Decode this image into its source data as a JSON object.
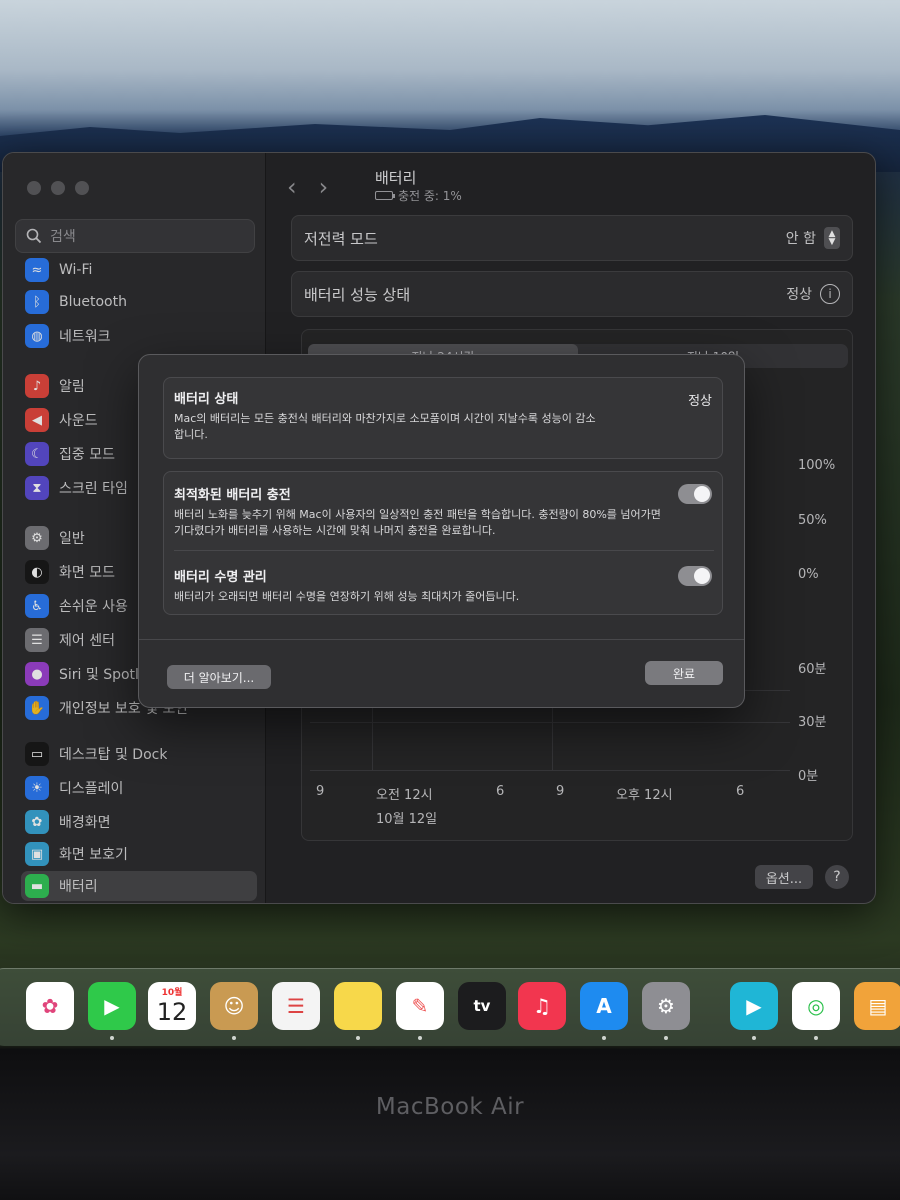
{
  "sidebar": {
    "search_placeholder": "검색",
    "items": [
      {
        "label": "Wi-Fi",
        "icon": "wifi-icon",
        "color": "#2d7cf6"
      },
      {
        "label": "Bluetooth",
        "icon": "bluetooth-icon",
        "color": "#2d7cf6"
      },
      {
        "label": "네트워크",
        "icon": "globe-icon",
        "color": "#2d7cf6"
      },
      {
        "label": "알림",
        "icon": "bell-icon",
        "color": "#e5483f"
      },
      {
        "label": "사운드",
        "icon": "speaker-icon",
        "color": "#e5483f"
      },
      {
        "label": "집중 모드",
        "icon": "moon-icon",
        "color": "#5e4fd6"
      },
      {
        "label": "스크린 타임",
        "icon": "hourglass-icon",
        "color": "#5e4fd6"
      },
      {
        "label": "일반",
        "icon": "gear-icon",
        "color": "#7c7c80"
      },
      {
        "label": "화면 모드",
        "icon": "appearance-icon",
        "color": "#1a1a1a"
      },
      {
        "label": "손쉬운 사용",
        "icon": "accessibility-icon",
        "color": "#2d7cf6"
      },
      {
        "label": "제어 센터",
        "icon": "control-center-icon",
        "color": "#7c7c80"
      },
      {
        "label": "Siri 및 Spotlight",
        "icon": "siri-icon",
        "color": "#9f44d3"
      },
      {
        "label": "개인정보 보호 및 보안",
        "icon": "hand-icon",
        "color": "#2d7cf6"
      },
      {
        "label": "데스크탑 및 Dock",
        "icon": "dock-icon",
        "color": "#1a1a1a"
      },
      {
        "label": "디스플레이",
        "icon": "sun-icon",
        "color": "#2d7cf6"
      },
      {
        "label": "배경화면",
        "icon": "flower-icon",
        "color": "#3aa7d6"
      },
      {
        "label": "화면 보호기",
        "icon": "screensaver-icon",
        "color": "#3aa7d6"
      },
      {
        "label": "배터리",
        "icon": "battery-icon",
        "color": "#34c759"
      }
    ]
  },
  "main": {
    "title": "배터리",
    "subtitle": "충전 중: 1%",
    "low_power_label": "저전력 모드",
    "low_power_value": "안 함",
    "health_label": "배터리 성능 상태",
    "health_value": "정상",
    "tabs": [
      "지난 24시간",
      "지난 10일"
    ],
    "level_axis": [
      "100%",
      "50%",
      "0%"
    ],
    "usage_axis": [
      "60분",
      "30분",
      "0분"
    ],
    "x_axis": [
      "9",
      "오전 12시",
      "6",
      "9",
      "오후 12시",
      "6"
    ],
    "date_label": "10월 12일",
    "options_button": "옵션...",
    "help_button": "?"
  },
  "sheet": {
    "health_title": "배터리 상태",
    "health_status": "정상",
    "health_desc": "Mac의 배터리는 모든 충전식 배터리와 마찬가지로 소모품이며 시간이 지날수록 성능이 감소합니다.",
    "optimized_title": "최적화된 배터리 충전",
    "optimized_desc": "배터리 노화를 늦추기 위해 Mac이 사용자의 일상적인 충전 패턴을 학습합니다. 충전량이 80%를 넘어가면 기다렸다가 배터리를 사용하는 시간에 맞춰 나머지 충전을 완료합니다.",
    "optimized_on": true,
    "lifespan_title": "배터리 수명 관리",
    "lifespan_desc": "배터리가 오래되면 배터리 수명을 연장하기 위해 성능 최대치가 줄어듭니다.",
    "lifespan_on": true,
    "learn_more": "더 알아보기...",
    "done": "완료"
  },
  "dock": {
    "apps": [
      "photos",
      "facetime",
      "calendar",
      "contacts",
      "reminders",
      "notes",
      "freeform",
      "tv",
      "music",
      "app-store",
      "system-settings",
      "infuse",
      "find-my",
      "pages"
    ],
    "calendar_month": "10월",
    "calendar_day": "12",
    "tv_label": "tv"
  },
  "device_brand": "MacBook Air"
}
